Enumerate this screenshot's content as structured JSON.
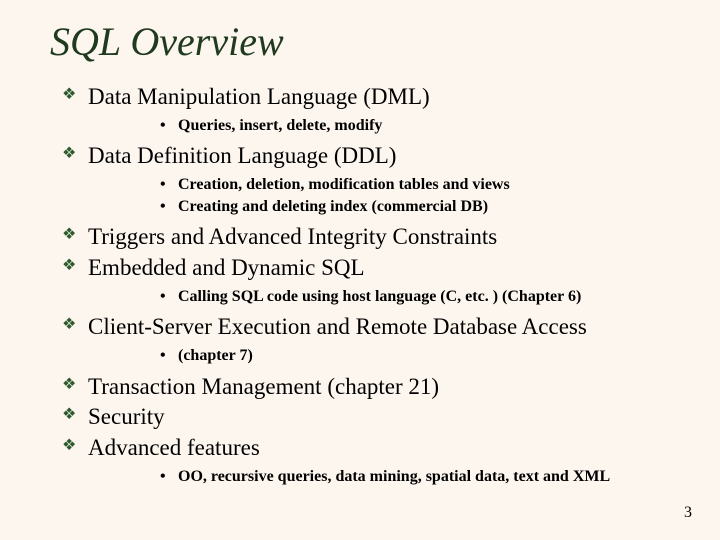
{
  "title": "SQL Overview",
  "page_number": "3",
  "items": {
    "i0": {
      "text": "Data Manipulation Language (DML)"
    },
    "i0s0": {
      "text": "Queries, insert, delete, modify"
    },
    "i1": {
      "text": "Data Definition Language (DDL)"
    },
    "i1s0": {
      "text": "Creation, deletion, modification tables and views"
    },
    "i1s1": {
      "text": "Creating and deleting index (commercial DB)"
    },
    "i2": {
      "text": "Triggers and Advanced Integrity Constraints"
    },
    "i3": {
      "text": "Embedded and Dynamic SQL"
    },
    "i3s0": {
      "text": "Calling SQL code using host language (C, etc. ) (Chapter 6)"
    },
    "i4": {
      "text": "Client-Server Execution and Remote Database Access"
    },
    "i4s0": {
      "text": " (chapter 7)"
    },
    "i5": {
      "text": "Transaction Management (chapter 21)"
    },
    "i6": {
      "text": "Security"
    },
    "i7": {
      "text": "Advanced features"
    },
    "i7s0": {
      "text": "OO, recursive queries, data mining, spatial data, text and XML"
    }
  }
}
